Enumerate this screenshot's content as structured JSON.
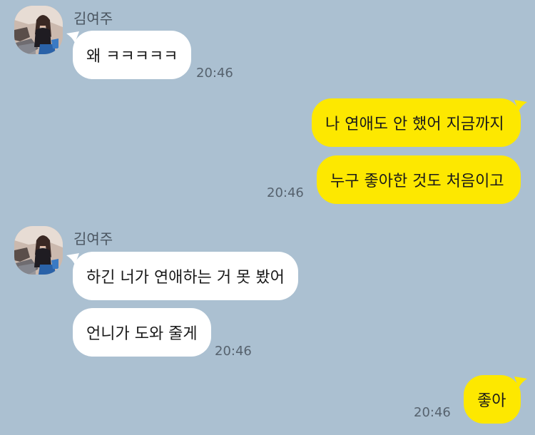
{
  "chat": {
    "messages": [
      {
        "sender": "김여주",
        "direction": "incoming",
        "texts": [
          "왜 ㅋㅋㅋㅋㅋ"
        ],
        "time": "20:46"
      },
      {
        "direction": "outgoing",
        "texts": [
          "나 연애도 안 했어 지금까지",
          "누구 좋아한 것도 처음이고"
        ],
        "time": "20:46"
      },
      {
        "sender": "김여주",
        "direction": "incoming",
        "texts": [
          "하긴 너가 연애하는 거 못 봤어",
          "언니가 도와 줄게"
        ],
        "time": "20:46"
      },
      {
        "direction": "outgoing",
        "texts": [
          "좋아"
        ],
        "time": "20:46"
      }
    ]
  },
  "colors": {
    "background": "#abc0d1",
    "incoming_bubble": "#ffffff",
    "outgoing_bubble": "#fde800"
  }
}
